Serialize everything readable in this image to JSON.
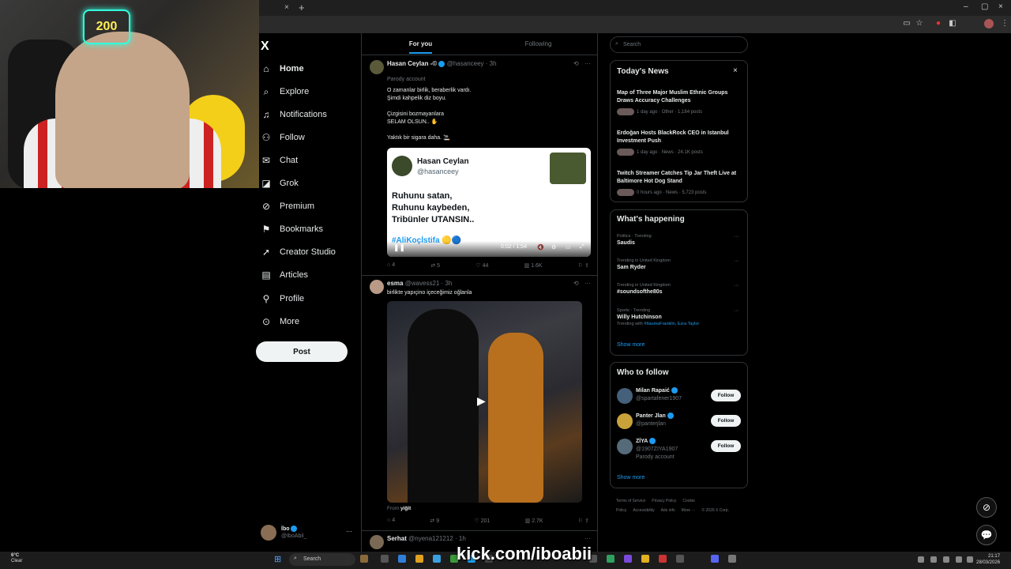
{
  "browser": {
    "close_tab": "×",
    "new_tab": "+",
    "min": "–",
    "max": "▢",
    "close": "×"
  },
  "nav": {
    "logo": "X",
    "items": [
      {
        "label": "Home",
        "icon": "home-icon",
        "glyph": "⌂"
      },
      {
        "label": "Explore",
        "icon": "search-icon",
        "glyph": "⌕"
      },
      {
        "label": "Notifications",
        "icon": "bell-icon",
        "glyph": "♫"
      },
      {
        "label": "Follow",
        "icon": "add-user-icon",
        "glyph": "⚇"
      },
      {
        "label": "Chat",
        "icon": "mail-icon",
        "glyph": "✉"
      },
      {
        "label": "Grok",
        "icon": "grok-icon",
        "glyph": "◪"
      },
      {
        "label": "Premium",
        "icon": "premium-icon",
        "glyph": "⊘"
      },
      {
        "label": "Bookmarks",
        "icon": "bookmark-icon",
        "glyph": "⚑"
      },
      {
        "label": "Creator Studio",
        "icon": "rocket-icon",
        "glyph": "➚"
      },
      {
        "label": "Articles",
        "icon": "article-icon",
        "glyph": "▤"
      },
      {
        "label": "Profile",
        "icon": "profile-icon",
        "glyph": "⚲"
      },
      {
        "label": "More",
        "icon": "more-icon",
        "glyph": "⊙"
      }
    ],
    "post_label": "Post",
    "account": {
      "name": "İbo",
      "handle": "@IboAbil_",
      "more": "···"
    }
  },
  "tabs": {
    "for_you": "For you",
    "following": "Following"
  },
  "posts": [
    {
      "name": "Hasan Ceylan -©",
      "handle": "@hasanceey",
      "time": "· 3h",
      "sub": "Parody account",
      "text": "O zamanlar birlik, beraberlik vardı.\nŞimdi kahpelik diz boyu.\n\nÇizgisini bozmayanlara\nSELAM OLSUN.. ✋\n\nYaktık bir sigara daha. 🚬",
      "embed": {
        "name": "Hasan Ceylan",
        "handle": "@hasanceey",
        "text": "Ruhunu satan,\nRuhunu kaybeden,\nTribünler UTANSIN..",
        "tag": "#AliKoçİstifa 🟡🔵",
        "time": "0:02 / 1:54"
      },
      "stats": {
        "replies": "4",
        "reposts": "5",
        "likes": "44",
        "views": "1.6K"
      }
    },
    {
      "name": "esma",
      "handle": "@wavess21",
      "time": "· 3h",
      "text": "birlikte yapıçino içeceğimiz oğlanla",
      "from_label": "From",
      "from_name": "yiğit",
      "stats": {
        "replies": "4",
        "reposts": "9",
        "likes": "201",
        "views": "2.7K"
      }
    },
    {
      "name": "Serhat",
      "handle": "@nyena121212",
      "time": "· 1h"
    }
  ],
  "right": {
    "search_placeholder": "Search",
    "news": {
      "title": "Today's News",
      "close": "×",
      "items": [
        {
          "headline": "Map of Three Major Muslim Ethnic Groups Draws Accuracy Challenges",
          "meta": "1 day ago · Other · 1,184 posts"
        },
        {
          "headline": "Erdoğan Hosts BlackRock CEO in Istanbul Investment Push",
          "meta": "1 day ago · News · 24.1K posts"
        },
        {
          "headline": "Twitch Streamer Catches Tip Jar Theft Live at Baltimore Hot Dog Stand",
          "meta": "0 hours ago · News · 5,723 posts"
        }
      ]
    },
    "happening": {
      "title": "What's happening",
      "items": [
        {
          "cat": "Politics · Trending",
          "name": "Saudis"
        },
        {
          "cat": "Trending in United Kingdom",
          "name": "Sam Ryder"
        },
        {
          "cat": "Trending in United Kingdom",
          "name": "#soundsofthe80s"
        },
        {
          "cat": "Sports · Trending",
          "name": "Willy Hutchinson",
          "extra_label": "Trending with",
          "extra": "#ItaumaFranklin, Ezra Taylor"
        }
      ],
      "show_more": "Show more"
    },
    "who": {
      "title": "Who to follow",
      "items": [
        {
          "name": "Milan Rapaić",
          "handle": "@spartafener1907",
          "btn": "Follow"
        },
        {
          "name": "Panter Jlan",
          "handle": "@panterjlan",
          "btn": "Follow"
        },
        {
          "name": "ZİYA",
          "handle": "@1907ZIYA1907",
          "sub": "Parody account",
          "btn": "Follow"
        }
      ],
      "show_more": "Show more"
    },
    "footer": [
      "Terms of Service",
      "Privacy Policy",
      "Cookie Policy",
      "Accessibility",
      "Ads info",
      "More ···",
      "© 2026 X Corp."
    ]
  },
  "taskbar": {
    "weather_temp": "6°C",
    "weather_desc": "Clear",
    "search": "Search",
    "overlay": "kick.com/iboabii",
    "time": "21:17",
    "date": "28/03/2026"
  }
}
